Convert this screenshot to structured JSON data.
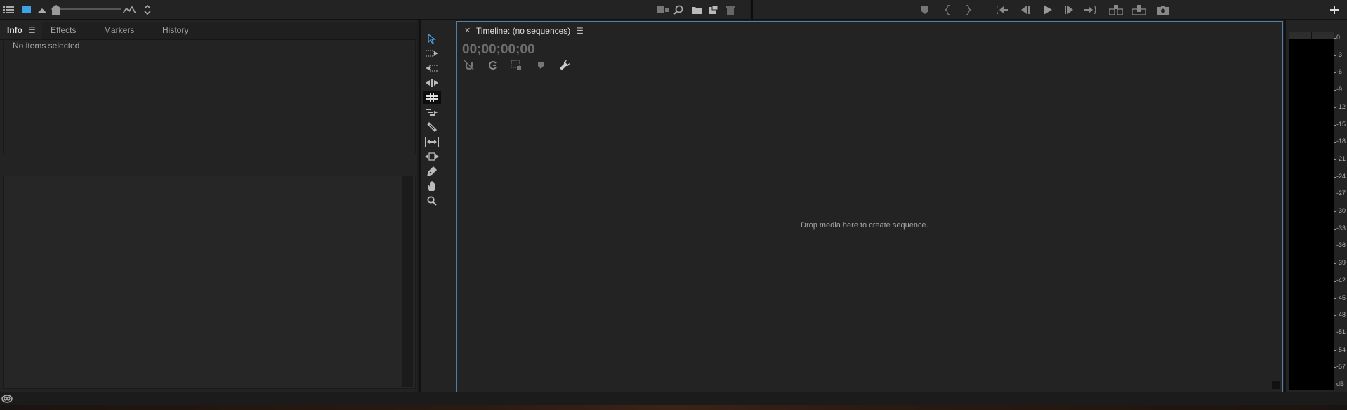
{
  "tabs": [
    {
      "label": "Info",
      "active": true
    },
    {
      "label": "Effects"
    },
    {
      "label": "Markers"
    },
    {
      "label": "History"
    }
  ],
  "info": {
    "empty_message": "No items selected"
  },
  "timeline": {
    "title": "Timeline: (no sequences)",
    "timecode": "00;00;00;00",
    "drop_message": "Drop media here to create sequence."
  },
  "meter": {
    "scale": [
      "0",
      "-3",
      "-6",
      "-9",
      "-12",
      "-15",
      "-18",
      "-21",
      "-24",
      "-27",
      "-30",
      "-33",
      "-36",
      "-39",
      "-42",
      "-45",
      "-48",
      "-51",
      "-54",
      "-57"
    ],
    "unit": "dB"
  },
  "colors": {
    "accent": "#4d7fa8",
    "active_icon": "#3ea3e6",
    "background": "#232323"
  },
  "icons": {
    "topbar_left": [
      "list-view-icon",
      "icon-view-icon",
      "zoom-out-icon",
      "zoom-slider-handle",
      "zoom-in-icon",
      "sort-icon"
    ],
    "topbar_left_right": [
      "automate-to-sequence-icon",
      "find-icon",
      "new-bin-icon",
      "new-item-icon",
      "clear-icon"
    ],
    "playback": [
      "add-marker-icon",
      "mark-in-icon",
      "mark-out-icon",
      "go-to-in-icon",
      "step-back-icon",
      "play-icon",
      "step-forward-icon",
      "go-to-out-icon",
      "insert-icon",
      "overwrite-icon",
      "export-frame-icon",
      "add-button-icon"
    ],
    "tools": [
      "selection-tool-icon",
      "track-select-forward-icon",
      "track-select-backward-icon",
      "ripple-edit-tool-icon",
      "rolling-edit-tool-icon",
      "rate-stretch-tool-icon",
      "razor-tool-icon",
      "slip-tool-icon",
      "slide-tool-icon",
      "pen-tool-icon",
      "hand-tool-icon",
      "zoom-tool-icon"
    ],
    "timeline_tools": [
      "snap-icon",
      "linked-selection-icon",
      "add-marker-icon",
      "timeline-display-settings-icon",
      "wrench-icon"
    ],
    "status": [
      "creative-cloud-icon"
    ]
  }
}
